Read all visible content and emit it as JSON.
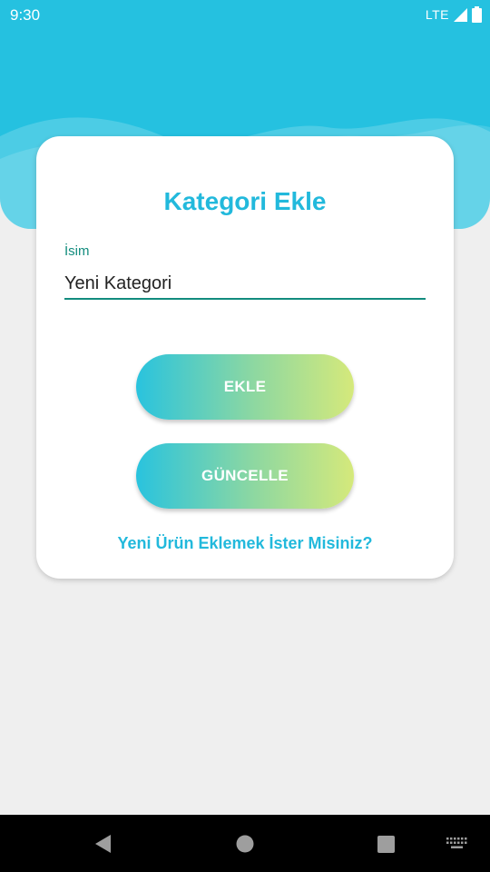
{
  "status_bar": {
    "time": "9:30",
    "network": "LTE",
    "icons": [
      "signal-icon",
      "battery-icon"
    ]
  },
  "card": {
    "title": "Kategori Ekle",
    "name_field": {
      "label": "İsim",
      "value": "Yeni Kategori"
    },
    "add_button": "EKLE",
    "update_button": "GÜNCELLE",
    "product_link": "Yeni Ürün Eklemek İster Misiniz?"
  },
  "nav_bar": {
    "icons": [
      "back-icon",
      "home-icon",
      "recents-icon",
      "keyboard-icon"
    ]
  },
  "colors": {
    "header": "#25c1e0",
    "accent": "#22b9dc",
    "field_accent": "#128c7e",
    "button_gradient": [
      "#29c3de",
      "#d5e97b"
    ],
    "background": "#efefef"
  }
}
